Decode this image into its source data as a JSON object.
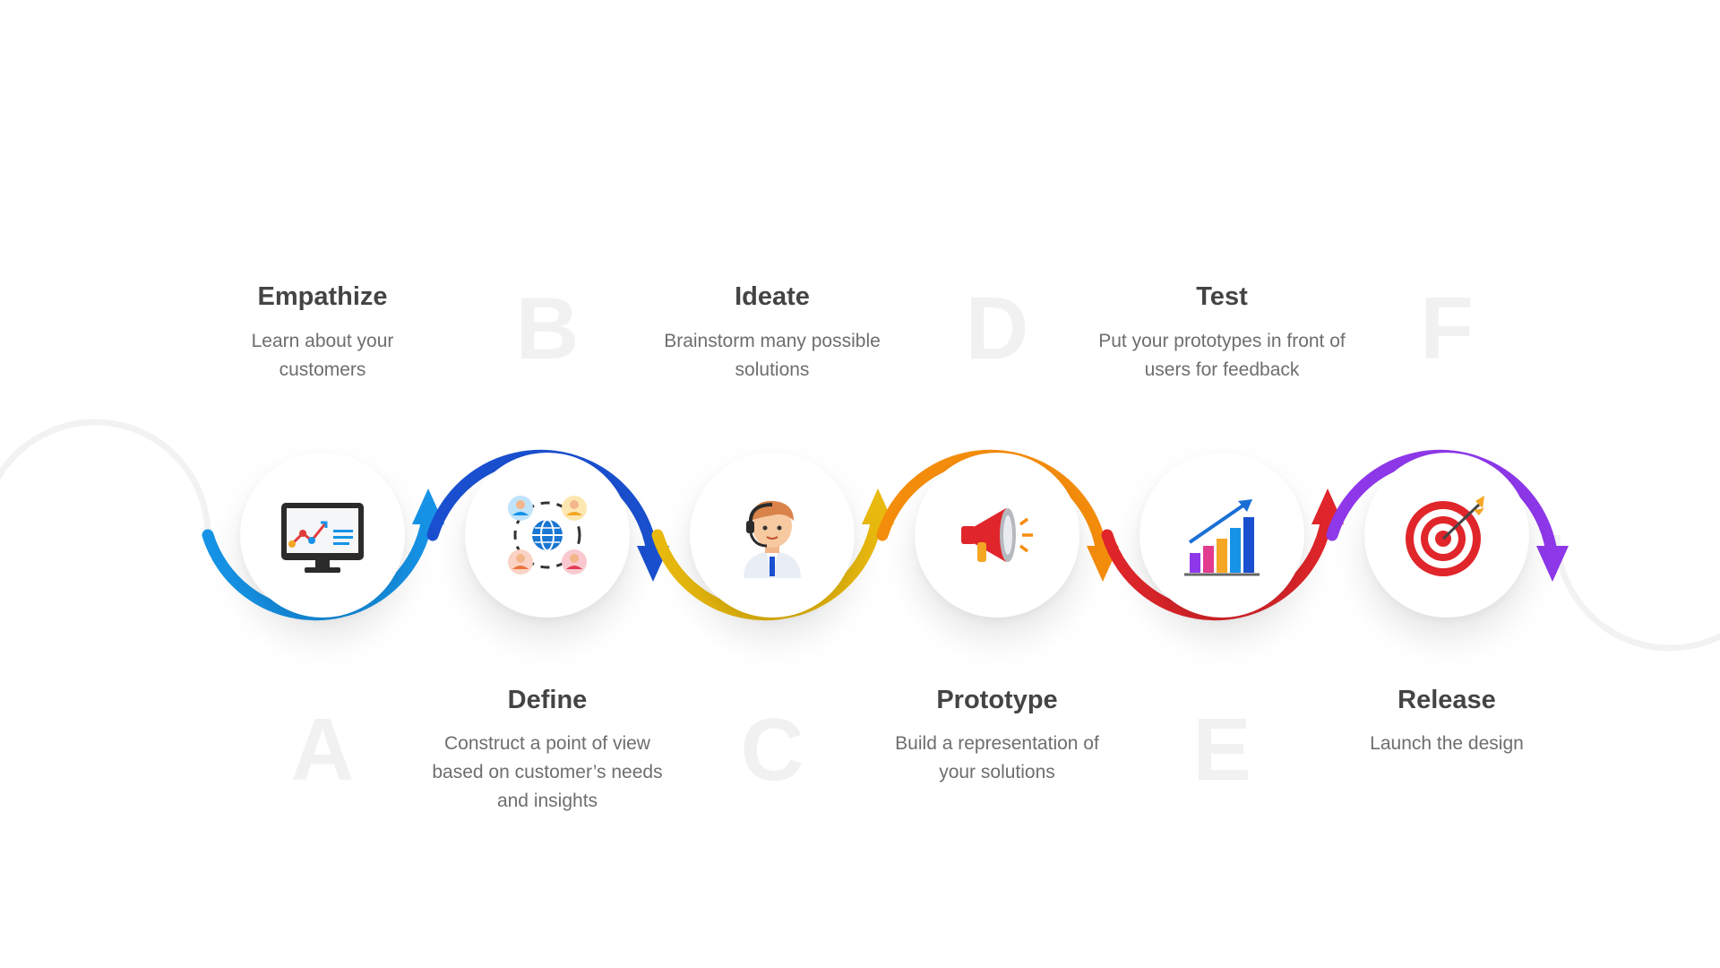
{
  "steps": [
    {
      "letter": "A",
      "title": "Empathize",
      "description": "Learn about your customers",
      "color": "#1693e6",
      "icon": "monitor-chart-icon"
    },
    {
      "letter": "B",
      "title": "Define",
      "description": "Construct a point of view based on customer’s needs and insights",
      "color": "#1a4fcf",
      "icon": "global-network-icon"
    },
    {
      "letter": "C",
      "title": "Ideate",
      "description": "Brainstorm many possible solutions",
      "color": "#e8b90e",
      "icon": "support-agent-icon"
    },
    {
      "letter": "D",
      "title": "Prototype",
      "description": "Build a representation of your solutions",
      "color": "#f58d0c",
      "icon": "megaphone-icon"
    },
    {
      "letter": "E",
      "title": "Test",
      "description": "Put your prototypes in front of users for feedback",
      "color": "#e0262b",
      "icon": "growth-chart-icon"
    },
    {
      "letter": "F",
      "title": "Release",
      "description": "Launch the design",
      "color": "#8e38ea",
      "icon": "target-icon"
    }
  ]
}
